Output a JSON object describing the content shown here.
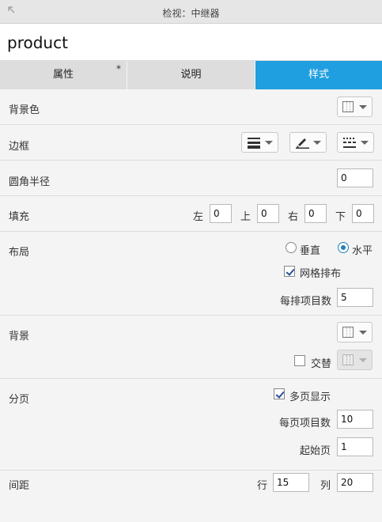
{
  "titlebar": {
    "title": "检视：中继器",
    "pin_icon": "collapse-arrow-icon"
  },
  "name": "product",
  "tabs": [
    {
      "label": "属性",
      "marker": "*"
    },
    {
      "label": "说明"
    },
    {
      "label": "样式",
      "active": true
    }
  ],
  "accent_color": "#1f9fe0",
  "bg_color": {
    "label": "背景色"
  },
  "border": {
    "label": "边框"
  },
  "corner_radius": {
    "label": "圆角半径",
    "value": "0"
  },
  "padding": {
    "label": "填充",
    "left_label": "左",
    "left": "0",
    "top_label": "上",
    "top": "0",
    "right_label": "右",
    "right": "0",
    "bottom_label": "下",
    "bottom": "0"
  },
  "layout": {
    "label": "布局",
    "vertical_label": "垂直",
    "horizontal_label": "水平",
    "selected": "水平",
    "grid_label": "网格排布",
    "grid_checked": true,
    "per_row_label": "每排项目数",
    "per_row": "5"
  },
  "background": {
    "label": "背景",
    "alternate_label": "交替",
    "alternate_checked": false
  },
  "paging": {
    "label": "分页",
    "multi_page_label": "多页显示",
    "multi_page_checked": true,
    "per_page_label": "每页项目数",
    "per_page": "10",
    "start_page_label": "起始页",
    "start_page": "1"
  },
  "spacing": {
    "label": "间距",
    "row_label": "行",
    "row": "15",
    "col_label": "列",
    "col": "20"
  }
}
